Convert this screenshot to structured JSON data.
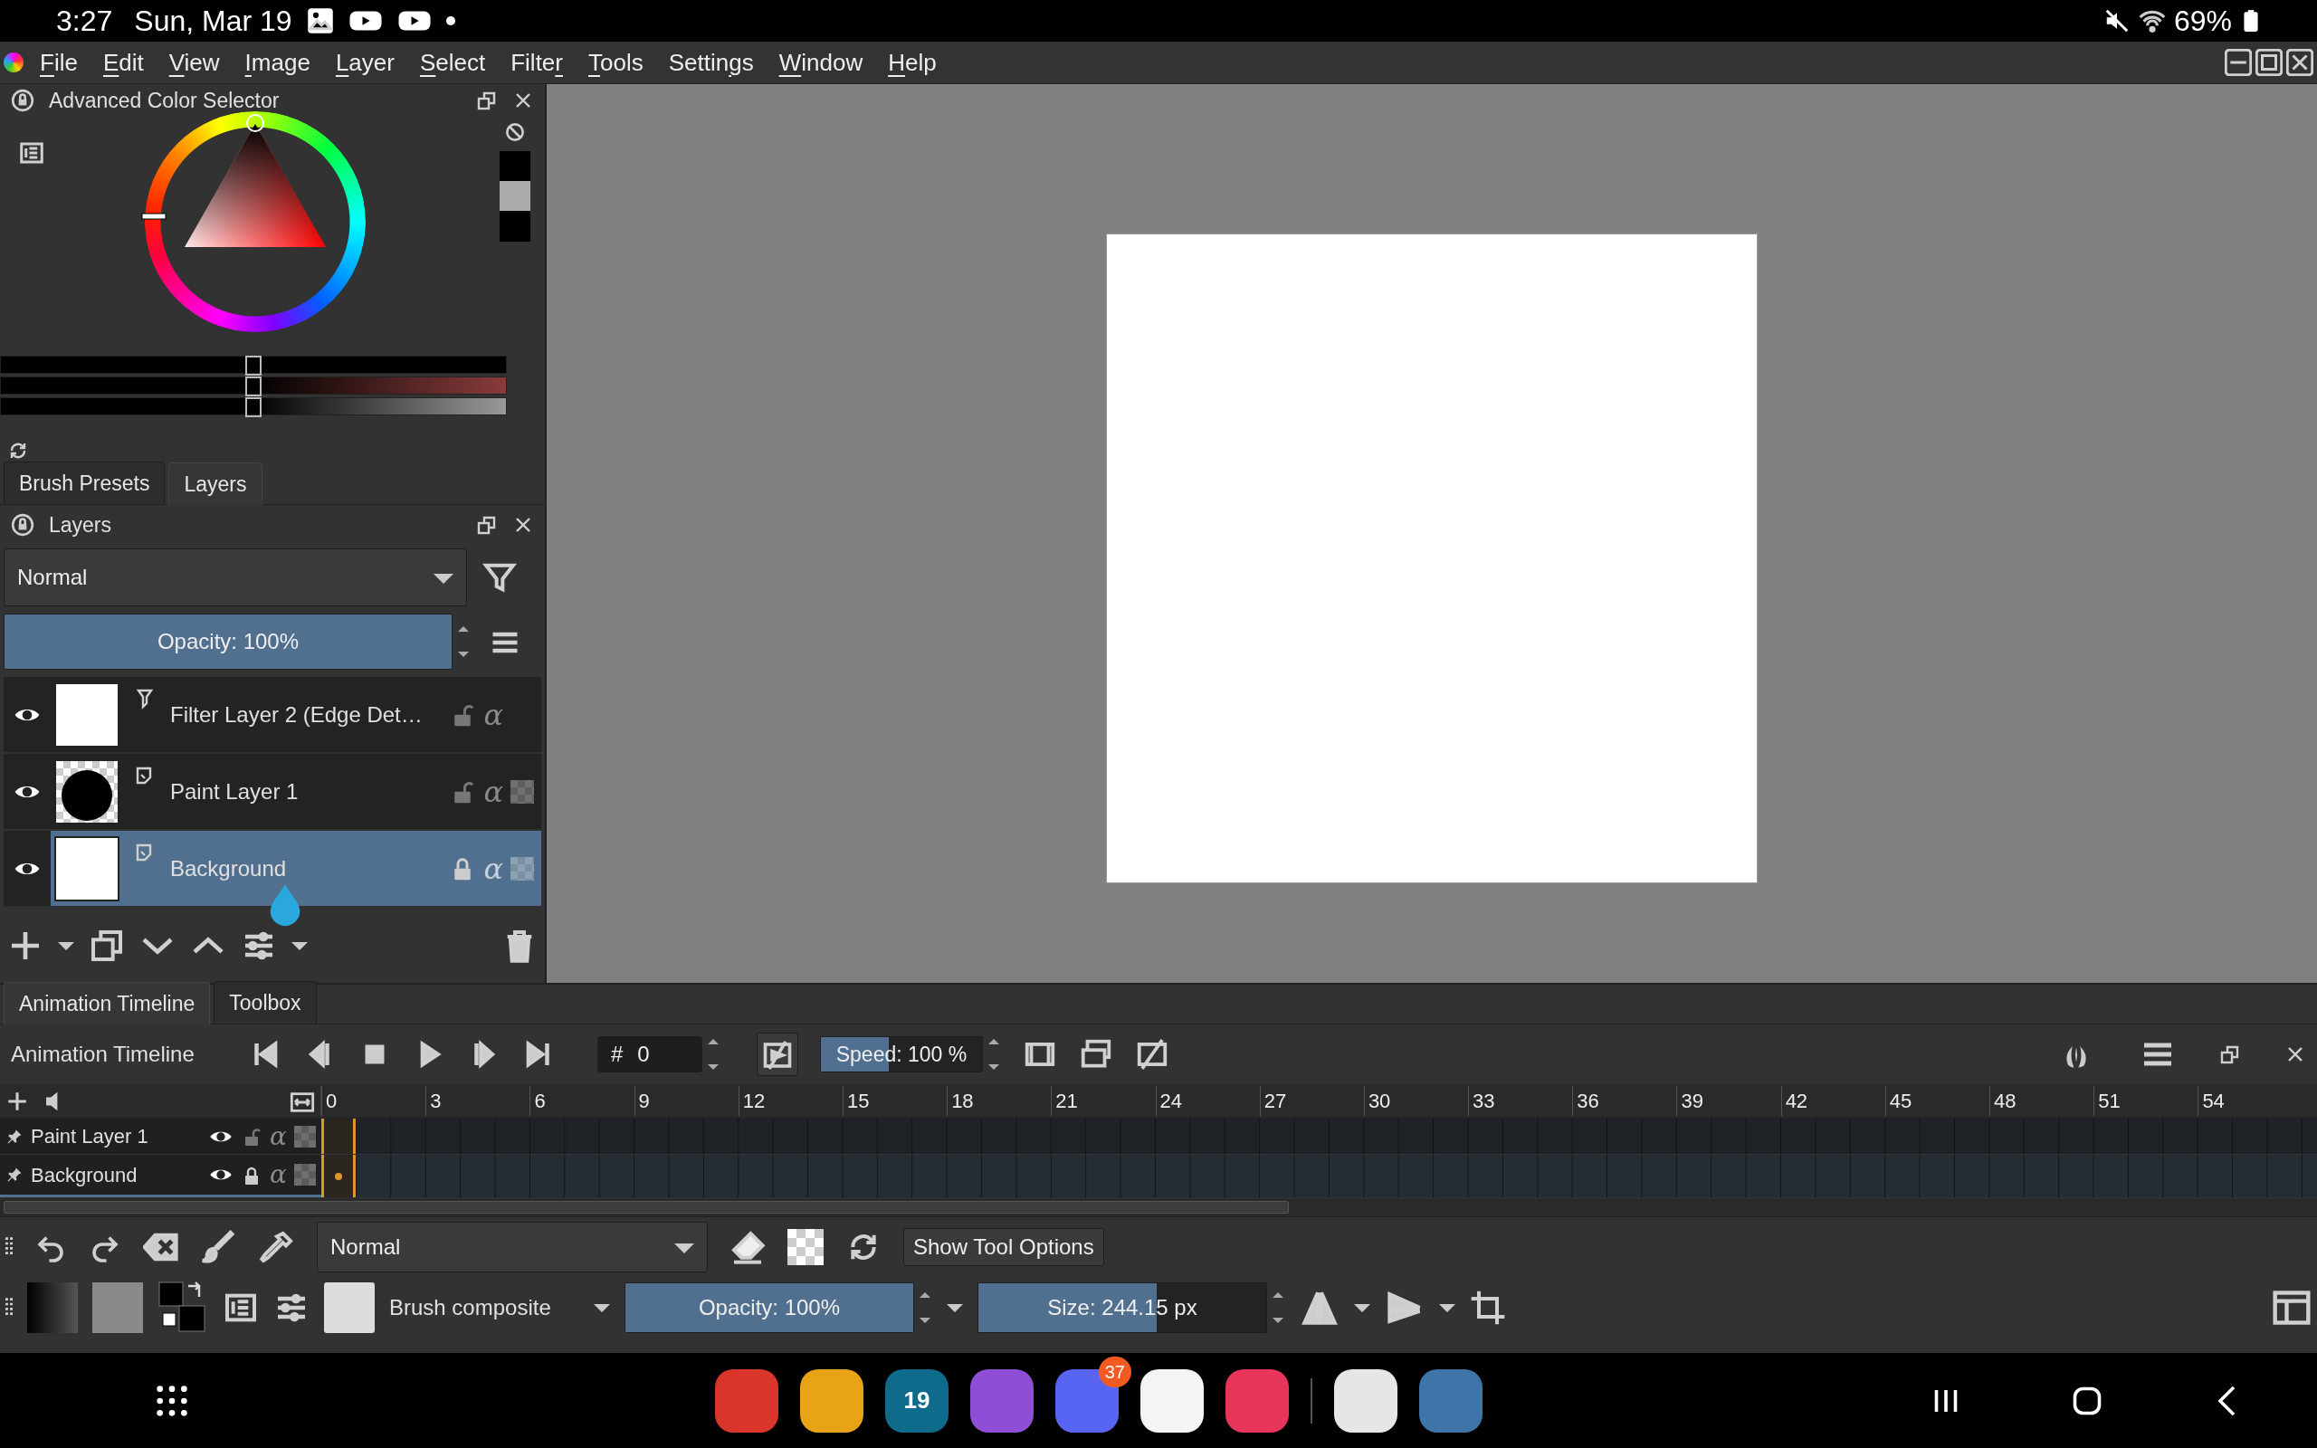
{
  "status_bar": {
    "time": "3:27",
    "date": "Sun, Mar 19",
    "battery": "69%"
  },
  "menu": [
    {
      "key": "F",
      "post": "ile"
    },
    {
      "key": "E",
      "post": "dit"
    },
    {
      "key": "V",
      "post": "iew"
    },
    {
      "key": "I",
      "post": "mage"
    },
    {
      "key": "L",
      "post": "ayer"
    },
    {
      "key": "S",
      "post": "elect"
    },
    {
      "pre": "Filte",
      "key": "r"
    },
    {
      "key": "T",
      "post": "ools"
    },
    {
      "pre": "Settin",
      "key": "g",
      "post": "s"
    },
    {
      "key": "W",
      "post": "indow"
    },
    {
      "key": "H",
      "post": "elp"
    }
  ],
  "color_selector": {
    "title": "Advanced Color Selector",
    "sliders": [
      {
        "level": 0.5
      },
      {
        "level": 0.5
      },
      {
        "level": 0.5
      }
    ]
  },
  "dock_tabs": [
    {
      "label": "Brush Presets",
      "selected": false
    },
    {
      "label": "Layers",
      "selected": true
    }
  ],
  "layers_panel": {
    "title": "Layers",
    "blend_mode": "Normal",
    "opacity": {
      "label": "Opacity:  100%",
      "level": 1
    },
    "layers": [
      {
        "name": "Filter Layer 2 (Edge Det…",
        "kind": "filter",
        "thumbnail": {
          "kind": "blank"
        },
        "selected": false,
        "locked": false,
        "alpha_symbol": "α"
      },
      {
        "name": "Paint Layer 1",
        "kind": "paint",
        "thumbnail": {
          "kind": "circle"
        },
        "selected": false,
        "locked": false,
        "alpha_symbol": "α"
      },
      {
        "name": "Background",
        "kind": "paint",
        "thumbnail": {
          "kind": "blank"
        },
        "selected": true,
        "locked": true,
        "alpha_symbol": "α"
      }
    ]
  },
  "bottom_tabs": [
    {
      "label": "Animation Timeline",
      "selected": true
    },
    {
      "label": "Toolbox",
      "selected": false
    }
  ],
  "timeline": {
    "title": "Animation Timeline",
    "frame": {
      "prefix": "#",
      "value": "0"
    },
    "speed": {
      "label": "Speed: 100 %",
      "level": 0.42
    },
    "ruler": [
      "0",
      "3",
      "6",
      "9",
      "12",
      "15",
      "18",
      "21",
      "24",
      "27",
      "30",
      "33",
      "36",
      "39",
      "42",
      "45",
      "48",
      "51",
      "54"
    ],
    "rows": [
      {
        "name": "Paint Layer 1",
        "selected": false,
        "locked": false,
        "has_keyframe": false,
        "alpha_symbol": "α"
      },
      {
        "name": "Background",
        "selected": true,
        "locked": true,
        "has_keyframe": true,
        "alpha_symbol": "α"
      }
    ]
  },
  "tool_options": {
    "blend_mode": "Normal",
    "show_tool_options": "Show Tool Options",
    "preset": "Brush composite",
    "opacity": {
      "label": "Opacity: 100%",
      "level": 1
    },
    "size": {
      "label": "Size: 244.15 px",
      "level": 0.62
    }
  },
  "nav_apps": [
    {
      "color": "#d9352b"
    },
    {
      "color": "#e8a317"
    },
    {
      "color": "#0f6b8c",
      "label": "19"
    },
    {
      "color": "#8e4fd6"
    },
    {
      "color": "#5865f2",
      "badge": "37"
    },
    {
      "color": "#f4f4f4"
    },
    {
      "color": "#e8365a"
    },
    {
      "color": "#e6e6e6"
    },
    {
      "color": "#3f74a8"
    }
  ]
}
